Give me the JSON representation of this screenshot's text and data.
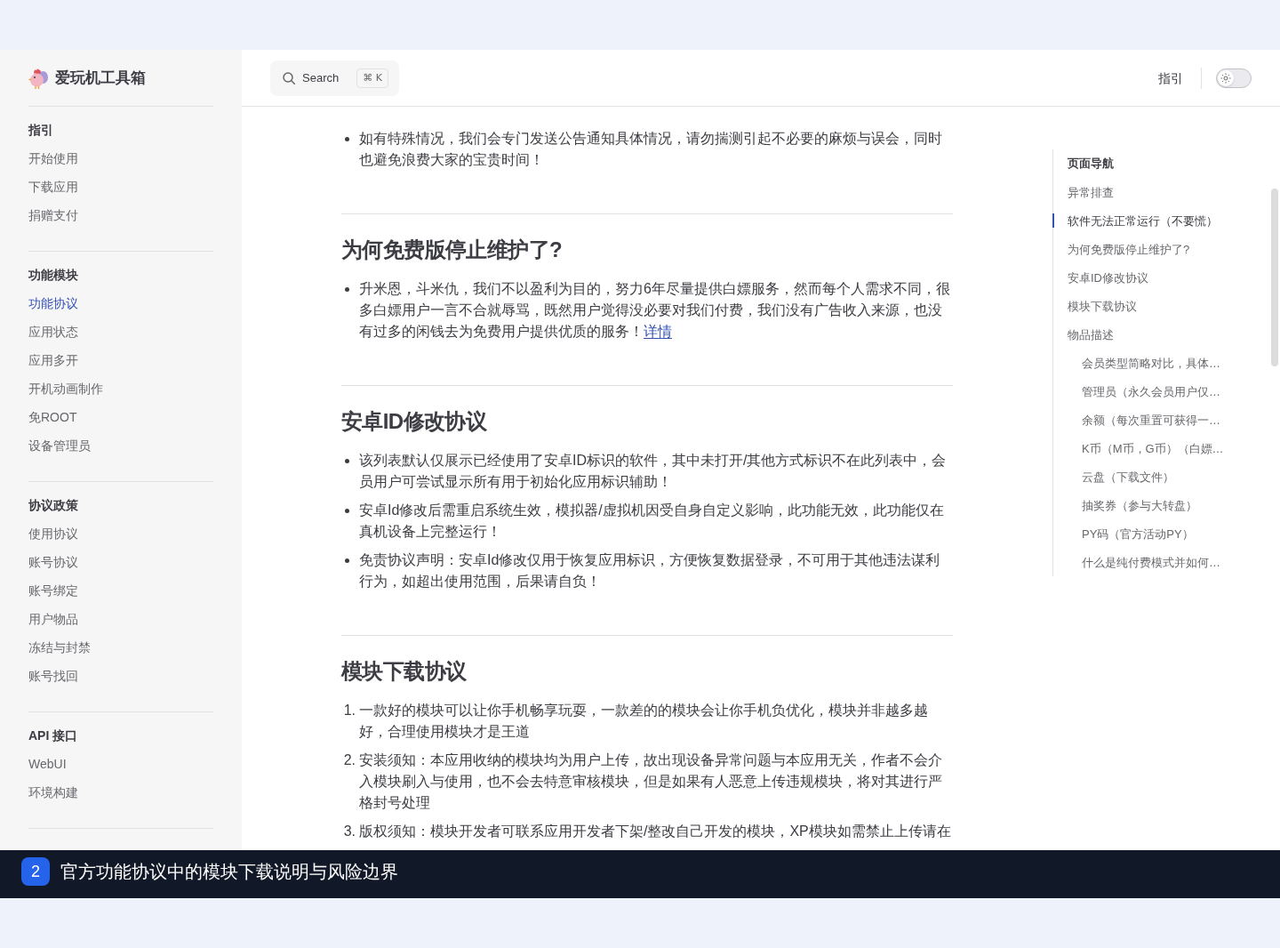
{
  "sidebar": {
    "logo": {
      "title": "爱玩机工具箱"
    },
    "groups": [
      {
        "title": "指引",
        "items": [
          {
            "label": "开始使用",
            "selected": false
          },
          {
            "label": "下载应用",
            "selected": false
          },
          {
            "label": "捐赠支付",
            "selected": false
          }
        ]
      },
      {
        "title": "功能模块",
        "items": [
          {
            "label": "功能协议",
            "selected": true
          },
          {
            "label": "应用状态",
            "selected": false
          },
          {
            "label": "应用多开",
            "selected": false
          },
          {
            "label": "开机动画制作",
            "selected": false
          },
          {
            "label": "免ROOT",
            "selected": false
          },
          {
            "label": "设备管理员",
            "selected": false
          }
        ]
      },
      {
        "title": "协议政策",
        "items": [
          {
            "label": "使用协议",
            "selected": false
          },
          {
            "label": "账号协议",
            "selected": false
          },
          {
            "label": "账号绑定",
            "selected": false
          },
          {
            "label": "用户物品",
            "selected": false
          },
          {
            "label": "冻结与封禁",
            "selected": false
          },
          {
            "label": "账号找回",
            "selected": false
          }
        ]
      },
      {
        "title": "API 接口",
        "items": [
          {
            "label": "WebUI",
            "selected": false
          },
          {
            "label": "环境构建",
            "selected": false
          }
        ]
      }
    ]
  },
  "header": {
    "search": {
      "label": "Search",
      "shortcut": "⌘ K"
    },
    "nav": [
      {
        "label": "指引"
      }
    ],
    "appearance_switch": {
      "checked": false
    }
  },
  "article": {
    "sections": [
      {
        "list": {
          "kind": "bullet",
          "items": [
            {
              "text": "如有特殊情况，我们会专门发送公告通知具体情况，请勿揣测引起不必要的麻烦与误会，同时也避免浪费大家的宝贵时间！"
            }
          ]
        }
      },
      {
        "heading": "为何免费版停止维护了?",
        "list": {
          "kind": "bullet",
          "items": [
            {
              "text": "升米恩，斗米仇，我们不以盈利为目的，努力6年尽量提供白嫖服务，然而每个人需求不同，很多白嫖用户一言不合就辱骂，既然用户觉得没必要对我们付费，我们没有广告收入来源，也没有过多的闲钱去为免费用户提供优质的服务！",
              "link": "详情"
            }
          ]
        }
      },
      {
        "heading": "安卓ID修改协议",
        "list": {
          "kind": "bullet",
          "items": [
            {
              "text": "该列表默认仅展示已经使用了安卓ID标识的软件，其中未打开/其他方式标识不在此列表中，会员用户可尝试显示所有用于初始化应用标识辅助！"
            },
            {
              "text": "安卓Id修改后需重启系统生效，模拟器/虚拟机因受自身自定义影响，此功能无效，此功能仅在真机设备上完整运行！"
            },
            {
              "text": "免责协议声明：安卓Id修改仅用于恢复应用标识，方便恢复数据登录，不可用于其他违法谋利行为，如超出使用范围，后果请自负！"
            }
          ]
        }
      },
      {
        "heading": "模块下载协议",
        "list": {
          "kind": "ordered",
          "items": [
            {
              "number": "1.",
              "text": "一款好的模块可以让你手机畅享玩耍，一款差的的模块会让你手机负优化，模块并非越多越好，合理使用模块才是王道"
            },
            {
              "number": "2.",
              "text": "安装须知：本应用收纳的模块均为用户上传，故出现设备异常问题与本应用无关，作者不会介入模块刷入与使用，也不会去特意审核模块，但是如果有人恶意上传违规模块，将对其进行严格封号处理"
            },
            {
              "number": "3.",
              "text": "版权须知：模块开发者可联系应用开发者下架/整改自己开发的模块，XP模块如需禁止上传请在"
            }
          ]
        }
      }
    ]
  },
  "outline": {
    "title": "页面导航",
    "items": [
      {
        "label": "异常排查",
        "selected": false
      },
      {
        "label": "软件无法正常运行（不要慌）",
        "selected": true
      },
      {
        "label": "为何免费版停止维护了?",
        "selected": false
      },
      {
        "label": "安卓ID修改协议",
        "selected": false
      },
      {
        "label": "模块下载协议",
        "selected": false
      },
      {
        "label": "物品描述",
        "selected": false,
        "children": [
          {
            "label": "会员类型简略对比，具体…",
            "selected": false
          },
          {
            "label": "管理员（永久会员用户仅…",
            "selected": false
          },
          {
            "label": "余额（每次重置可获得一…",
            "selected": false
          },
          {
            "label": "K币（M币，G币）（白嫖…",
            "selected": false
          },
          {
            "label": "云盘（下载文件）",
            "selected": false
          },
          {
            "label": "抽奖券（参与大转盘）",
            "selected": false
          },
          {
            "label": "PY码（官方活动PY）",
            "selected": false
          },
          {
            "label": "什么是纯付费模式并如何…",
            "selected": false
          }
        ]
      }
    ]
  },
  "caption": {
    "number": "2",
    "text": "官方功能协议中的模块下载说明与风险边界"
  }
}
